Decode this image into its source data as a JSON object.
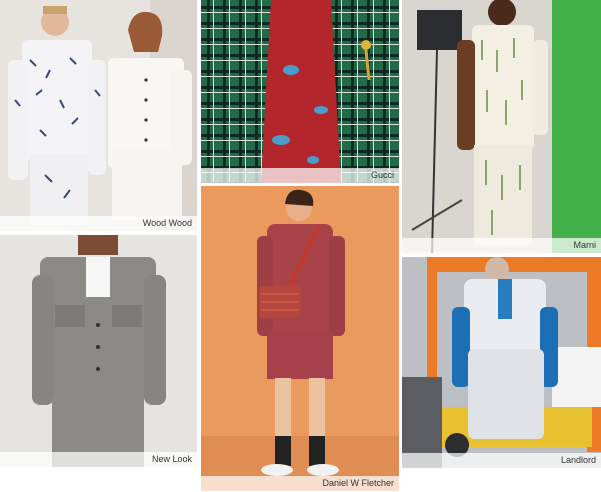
{
  "tiles": [
    {
      "caption": "Wood Wood"
    },
    {
      "caption": "Gucci"
    },
    {
      "caption": "Marni"
    },
    {
      "caption": "New Look"
    },
    {
      "caption": "Daniel W Fletcher"
    },
    {
      "caption": "Landlord"
    }
  ]
}
